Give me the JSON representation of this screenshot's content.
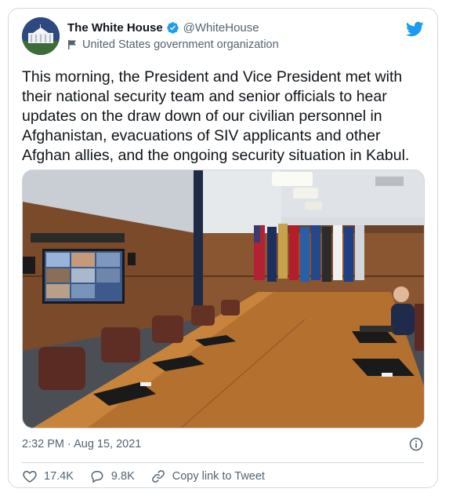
{
  "author": {
    "name": "The White House",
    "handle": "@WhiteHouse",
    "label": "United States government organization"
  },
  "icons": {
    "verified": "verified-badge-icon",
    "org_flag": "flag-icon",
    "brand": "twitter-bird-icon",
    "info": "info-icon",
    "like": "heart-icon",
    "reply": "reply-bubble-icon",
    "copy_link": "link-icon"
  },
  "tweet": {
    "text": "This morning, the President and Vice President met with their national security team and senior officials to hear updates on the draw down of our civilian personnel in Afghanistan, evacuations of SIV applicants and other Afghan allies, and the ongoing security situation in Kabul.",
    "timestamp": "2:32 PM · Aug 15, 2021"
  },
  "actions": {
    "likes": "17.4K",
    "replies": "9.8K",
    "copy_link": "Copy link to Tweet"
  },
  "colors": {
    "brand_blue": "#1d9bf0",
    "secondary_text": "#536471",
    "border": "#cfd9de"
  }
}
